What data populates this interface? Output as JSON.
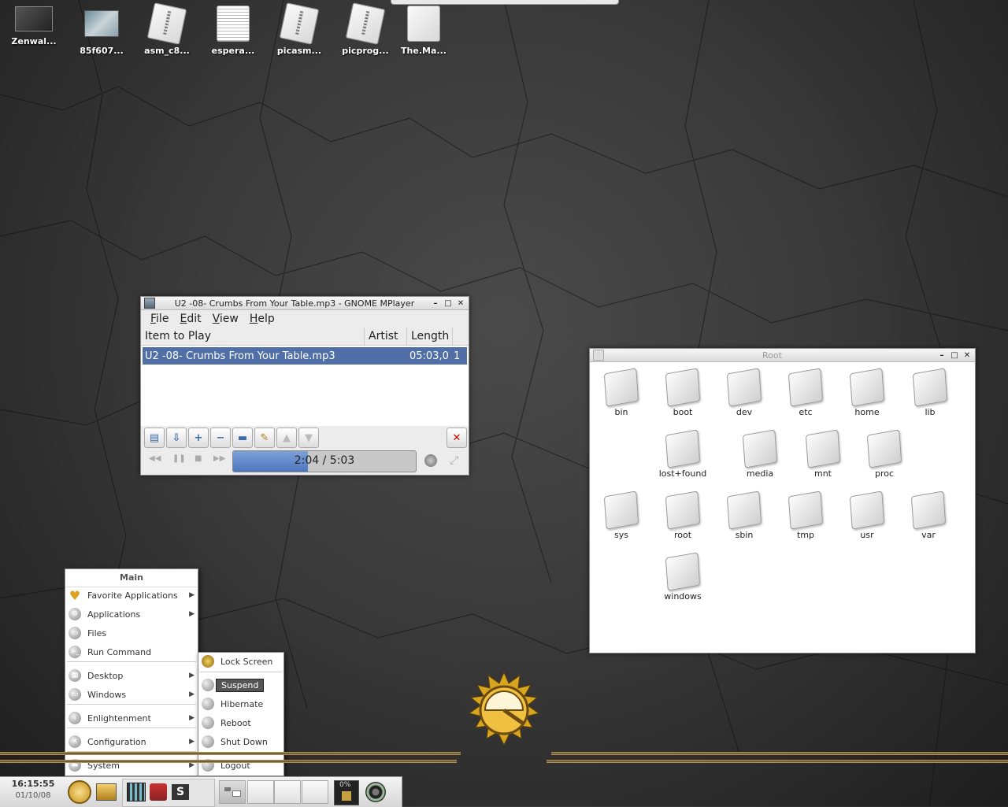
{
  "desktop": {
    "icons": [
      {
        "label": "Zenwal...",
        "icon": "image-icon"
      },
      {
        "label": "85f607...",
        "icon": "photo-icon"
      },
      {
        "label": "asm_c8...",
        "icon": "archive-icon"
      },
      {
        "label": "espera...",
        "icon": "text-document-icon"
      },
      {
        "label": "picasm...",
        "icon": "archive-icon"
      },
      {
        "label": "picprog...",
        "icon": "archive-icon"
      },
      {
        "label": "The.Ma...",
        "icon": "document-icon"
      }
    ]
  },
  "mplayer": {
    "title": "U2 -08- Crumbs From Your Table.mp3 - GNOME MPlayer",
    "menu": [
      "File",
      "Edit",
      "View",
      "Help"
    ],
    "columns": [
      "Item to Play",
      "Artist",
      "Length"
    ],
    "row": {
      "item": "U2 -08- Crumbs From Your Table.mp3",
      "artist": "",
      "length": "05:03,0",
      "count": "1"
    },
    "time_display": "2:04 /  5:03",
    "progress_fraction": 0.41
  },
  "file_manager": {
    "title": "Root",
    "folders": [
      "bin",
      "boot",
      "dev",
      "etc",
      "home",
      "lib",
      "lost+found",
      "media",
      "mnt",
      "proc",
      "sys",
      "root",
      "sbin",
      "tmp",
      "usr",
      "var",
      "windows"
    ]
  },
  "main_menu": {
    "header": "Main",
    "items": [
      {
        "label": "Favorite Applications",
        "icon": "heart-icon",
        "submenu": true
      },
      {
        "label": "Applications",
        "icon": "applications-icon",
        "submenu": true
      },
      {
        "label": "Files",
        "icon": "files-icon",
        "submenu": false
      },
      {
        "label": "Run Command",
        "icon": "terminal-icon",
        "submenu": false
      },
      {
        "label": "Desktop",
        "icon": "desktop-icon",
        "submenu": true
      },
      {
        "label": "Windows",
        "icon": "windows-icon",
        "submenu": true
      },
      {
        "label": "Enlightenment",
        "icon": "info-icon",
        "submenu": true
      },
      {
        "label": "Configuration",
        "icon": "config-icon",
        "submenu": true
      },
      {
        "label": "System",
        "icon": "system-icon",
        "submenu": true
      }
    ]
  },
  "system_menu": {
    "items": [
      {
        "label": "Lock Screen",
        "icon": "lock-icon"
      },
      {
        "label": "Suspend",
        "icon": "suspend-icon",
        "selected": true
      },
      {
        "label": "Hibernate",
        "icon": "hibernate-icon"
      },
      {
        "label": "Reboot",
        "icon": "reboot-icon"
      },
      {
        "label": "Shut Down",
        "icon": "shutdown-icon"
      },
      {
        "label": "Logout",
        "icon": "logout-icon"
      }
    ]
  },
  "shelf": {
    "time": "16:15:55",
    "date": "01/10/08",
    "cpu": "0%"
  },
  "colors": {
    "selection": "#4f6fa6",
    "progress": "#4e76c0",
    "menu_selected": "#555555"
  }
}
